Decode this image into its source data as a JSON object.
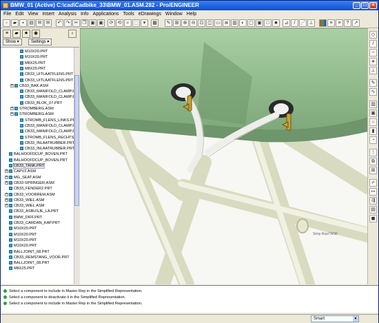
{
  "window": {
    "title": "BMW_01 (Active) C:\\cad\\Cadbike_33\\BMW_01.ASM.282 - Pro/ENGINEER"
  },
  "menu": [
    "File",
    "Edit",
    "View",
    "Insert",
    "Analysis",
    "Info",
    "Applications",
    "Tools",
    "eDrawings",
    "Window",
    "Help"
  ],
  "nav": {
    "show_label": "Show ▾",
    "settings_label": "Settings ▾"
  },
  "tree": [
    {
      "label": "M10X20.PRT",
      "indent": 3,
      "exp": ""
    },
    {
      "label": "M10X20.PRT",
      "indent": 3,
      "exp": ""
    },
    {
      "label": "M8X25.PRT",
      "indent": 3,
      "exp": ""
    },
    {
      "label": "M8X25.PRT",
      "indent": 3,
      "exp": ""
    },
    {
      "label": "CB33_UITLAATFLENS.PRT",
      "indent": 3,
      "exp": ""
    },
    {
      "label": "CB33_UITLAATFLENS.PRT",
      "indent": 3,
      "exp": ""
    },
    {
      "label": "CB33_BAK.ASM",
      "indent": 2,
      "exp": "+"
    },
    {
      "label": "CB33_MANIFOLD_CLAMP.PRT",
      "indent": 3,
      "exp": ""
    },
    {
      "label": "CB33_MANIFOLD_CLAMP.PRT",
      "indent": 3,
      "exp": ""
    },
    {
      "label": "CB33_BLOK_07.PRT",
      "indent": 3,
      "exp": ""
    },
    {
      "label": "STROMBERG.ASM",
      "indent": 2,
      "exp": "+"
    },
    {
      "label": "STROMBERG.ASM",
      "indent": 2,
      "exp": "+"
    },
    {
      "label": "STROMB_FLENS_LINKS.PRT",
      "indent": 3,
      "exp": ""
    },
    {
      "label": "CB33_MANIFOLD_CLAMP.PRT",
      "indent": 3,
      "exp": ""
    },
    {
      "label": "CB33_MANIFOLD_CLAMP.PRT",
      "indent": 3,
      "exp": ""
    },
    {
      "label": "STROMB_FLENS_RECHTS.PRT",
      "indent": 3,
      "exp": ""
    },
    {
      "label": "CB33_INLAATRUBBER.PRT",
      "indent": 3,
      "exp": ""
    },
    {
      "label": "CB33_INLAATRUBBER.PRT",
      "indent": 3,
      "exp": ""
    },
    {
      "label": "BALHOOFDCUP_BOVEN.PRT",
      "indent": 1,
      "exp": ""
    },
    {
      "label": "BALHOOFDCUP_BOVEN.PRT",
      "indent": 1,
      "exp": ""
    },
    {
      "label": "CB33_TANK.PRT",
      "indent": 1,
      "exp": "",
      "selected": true
    },
    {
      "label": "CAPV2.ASM",
      "indent": 1,
      "exp": "+"
    },
    {
      "label": "MG_SEAT.ASM",
      "indent": 1,
      "exp": "+"
    },
    {
      "label": "CB33-SPRINGER.ASM",
      "indent": 1,
      "exp": "+"
    },
    {
      "label": "CB33_FENDER2.PRT",
      "indent": 1,
      "exp": ""
    },
    {
      "label": "CB33_VOORREM.ASM",
      "indent": 1,
      "exp": "+"
    },
    {
      "label": "CB33_WIEL.ASM",
      "indent": 1,
      "exp": "+"
    },
    {
      "label": "CB33_WIEL.ASM",
      "indent": 1,
      "exp": "+"
    },
    {
      "label": "CB33_ASBUSJE_LA.PRT",
      "indent": 1,
      "exp": ""
    },
    {
      "label": "BMW_DIFF.PRT",
      "indent": 1,
      "exp": ""
    },
    {
      "label": "CB33_CARDAN_KAP.PRT",
      "indent": 1,
      "exp": ""
    },
    {
      "label": "M10X20.PRT",
      "indent": 1,
      "exp": ""
    },
    {
      "label": "M10X20.PRT",
      "indent": 1,
      "exp": ""
    },
    {
      "label": "M10X20.PRT",
      "indent": 1,
      "exp": ""
    },
    {
      "label": "M10X20.PRT",
      "indent": 1,
      "exp": ""
    },
    {
      "label": "BALLJOINT_68.PRT",
      "indent": 1,
      "exp": ""
    },
    {
      "label": "CB33_REMSTANG_VOOR.PRT",
      "indent": 1,
      "exp": ""
    },
    {
      "label": "BALLJOINT_68.PRT",
      "indent": 1,
      "exp": ""
    },
    {
      "label": "M8X25.PRT",
      "indent": 1,
      "exp": ""
    }
  ],
  "messages": [
    "Select a component to include in Master Rep in the Simplified Representation.",
    "Select a component to deactivate it in the Simplified Representation.",
    "Select a component to include in Master Rep in the Simplified Representation."
  ],
  "viewport": {
    "label": "Simp Rep/TANK"
  },
  "status": {
    "filter": "Smart"
  },
  "colors": {
    "frame": "#e4e6cc",
    "tank": "#8fba8c",
    "brass": "#c8a23a",
    "title": "#0b4fd8"
  }
}
